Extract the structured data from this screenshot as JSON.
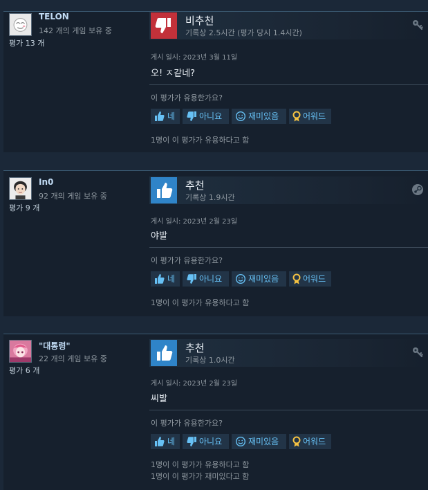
{
  "vote_buttons": {
    "yes": "네",
    "no": "아니요",
    "funny": "재미있음",
    "award": "어워드"
  },
  "colors": {
    "background": "#1b2838",
    "card": "#16202d",
    "link": "#67c1f5",
    "negative": "#c2313a",
    "positive": "#2f84c8"
  },
  "reviews": [
    {
      "reviewer": {
        "name": "TELON",
        "games": "142 개의 게임 보유 중",
        "review_count": "평가 13 개"
      },
      "verdict": "비추천",
      "verdict_icon": "thumbs-down-icon",
      "hours": "기록상 2.5시간 (평가 당시 1.4시간)",
      "corner_icon": "award-key-icon",
      "posted": "게시 일시: 2023년 3월 11일",
      "text": "오! ㅈ같네?",
      "question": "이 평가가 유용한가요?",
      "helpful": [
        "1명이 이 평가가 유용하다고 함"
      ]
    },
    {
      "reviewer": {
        "name": "In0",
        "games": "92 개의 게임 보유 중",
        "review_count": "평가 9 개"
      },
      "verdict": "추천",
      "verdict_icon": "thumbs-up-icon",
      "hours": "기록상 1.9시간",
      "corner_icon": "steam-logo-icon",
      "posted": "게시 일시: 2023년 2월 23일",
      "text": "야발",
      "question": "이 평가가 유용한가요?",
      "helpful": [
        "1명이 이 평가가 유용하다고 함"
      ]
    },
    {
      "reviewer": {
        "name": "\"대통령\"",
        "games": "22 개의 게임 보유 중",
        "review_count": "평가 6 개"
      },
      "verdict": "추천",
      "verdict_icon": "thumbs-up-icon",
      "hours": "기록상 1.0시간",
      "corner_icon": "award-key-icon",
      "posted": "게시 일시: 2023년 2월 23일",
      "text": "씨발",
      "question": "이 평가가 유용한가요?",
      "helpful": [
        "1명이 이 평가가 유용하다고 함",
        "1명이 이 평가가 재미있다고 함"
      ]
    }
  ]
}
